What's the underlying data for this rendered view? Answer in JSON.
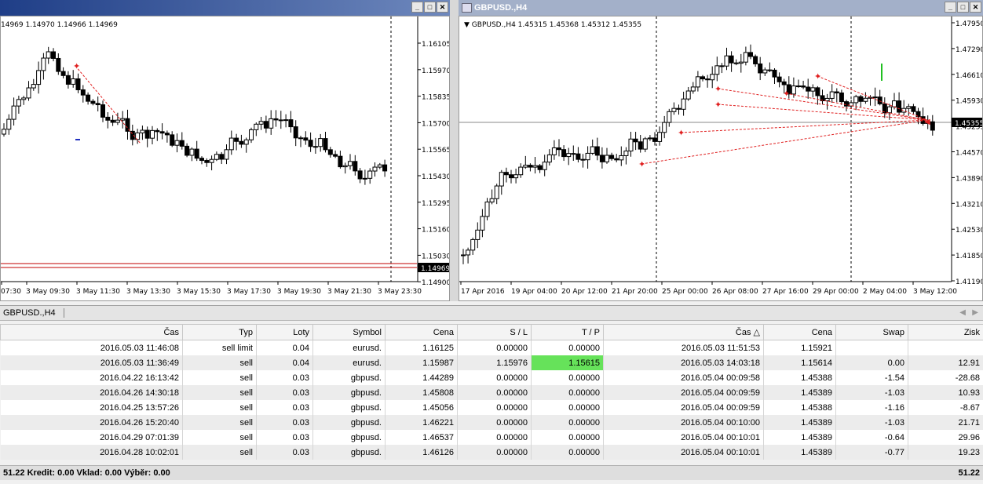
{
  "left_window": {
    "ohlc_text": "14969 1.14970 1.14966 1.14969",
    "price_labels": [
      "1.16105",
      "1.15970",
      "1.15835",
      "1.15700",
      "1.15565",
      "1.15430",
      "1.15295",
      "1.15160",
      "1.15030",
      "1.14900"
    ],
    "current_price": "1.14969",
    "time_labels": [
      "07:30",
      "3 May 09:30",
      "3 May 11:30",
      "3 May 13:30",
      "3 May 15:30",
      "3 May 17:30",
      "3 May 19:30",
      "3 May 21:30",
      "3 May 23:30"
    ]
  },
  "right_window": {
    "title": "GBPUSD.,H4",
    "ohlc_text": "GBPUSD.,H4  1.45315 1.45368 1.45312 1.45355",
    "price_labels": [
      "1.47950",
      "1.47290",
      "1.46610",
      "1.45930",
      "1.45255",
      "1.44570",
      "1.43890",
      "1.43210",
      "1.42530",
      "1.41850",
      "1.41190"
    ],
    "current_price": "1.45355",
    "time_labels": [
      "17 Apr 2016",
      "19 Apr 04:00",
      "20 Apr 12:00",
      "21 Apr 20:00",
      "25 Apr 00:00",
      "26 Apr 08:00",
      "27 Apr 16:00",
      "29 Apr 00:00",
      "2 May 04:00",
      "3 May 12:00"
    ]
  },
  "terminal": {
    "tab_label": "GBPUSD.,H4",
    "columns": [
      "Čas",
      "Typ",
      "Loty",
      "Symbol",
      "Cena",
      "S / L",
      "T / P",
      "Čas",
      "Cena",
      "Swap",
      "Zisk"
    ],
    "rows": [
      [
        "2016.05.03 11:46:08",
        "sell limit",
        "0.04",
        "eurusd.",
        "1.16125",
        "0.00000",
        "0.00000",
        "2016.05.03 11:51:53",
        "1.15921",
        "",
        ""
      ],
      [
        "2016.05.03 11:36:49",
        "sell",
        "0.04",
        "eurusd.",
        "1.15987",
        "1.15976",
        "1.15615",
        "2016.05.03 14:03:18",
        "1.15614",
        "0.00",
        "12.91"
      ],
      [
        "2016.04.22 16:13:42",
        "sell",
        "0.03",
        "gbpusd.",
        "1.44289",
        "0.00000",
        "0.00000",
        "2016.05.04 00:09:58",
        "1.45388",
        "-1.54",
        "-28.68"
      ],
      [
        "2016.04.26 14:30:18",
        "sell",
        "0.03",
        "gbpusd.",
        "1.45808",
        "0.00000",
        "0.00000",
        "2016.05.04 00:09:59",
        "1.45389",
        "-1.03",
        "10.93"
      ],
      [
        "2016.04.25 13:57:26",
        "sell",
        "0.03",
        "gbpusd.",
        "1.45056",
        "0.00000",
        "0.00000",
        "2016.05.04 00:09:59",
        "1.45388",
        "-1.16",
        "-8.67"
      ],
      [
        "2016.04.26 15:20:40",
        "sell",
        "0.03",
        "gbpusd.",
        "1.46221",
        "0.00000",
        "0.00000",
        "2016.05.04 00:10:00",
        "1.45389",
        "-1.03",
        "21.71"
      ],
      [
        "2016.04.29 07:01:39",
        "sell",
        "0.03",
        "gbpusd.",
        "1.46537",
        "0.00000",
        "0.00000",
        "2016.05.04 00:10:01",
        "1.45389",
        "-0.64",
        "29.96"
      ],
      [
        "2016.04.28 10:02:01",
        "sell",
        "0.03",
        "gbpusd.",
        "1.46126",
        "0.00000",
        "0.00000",
        "2016.05.04 00:10:01",
        "1.45389",
        "-0.77",
        "19.23"
      ]
    ],
    "status_left": "51.22  Kredit: 0.00  Vklad: 0.00  Výběr: 0.00",
    "status_right": "51.22"
  },
  "colors": {
    "title_active": "#3b5b9e",
    "title_inactive": "#8c9bb8",
    "tp_highlight": "#66e25a",
    "arrow": "#e02020",
    "trade_line": "#e02020"
  }
}
